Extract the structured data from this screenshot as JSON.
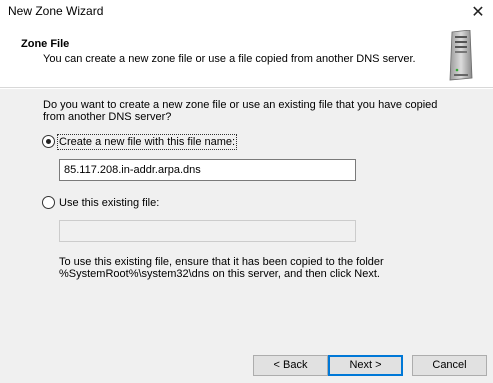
{
  "window": {
    "title": "New Zone Wizard",
    "close_glyph": "✕"
  },
  "header": {
    "title": "Zone File",
    "subtitle": "You can create a new zone file or use a file copied from another DNS server.",
    "icon": "server-icon"
  },
  "content": {
    "question": "Do you want to create a new zone file or use an existing file that you have copied from another DNS server?",
    "option_new": {
      "label": "Create a new file with this file name:",
      "selected": true,
      "value": "85.117.208.in-addr.arpa.dns"
    },
    "option_existing": {
      "label": "Use this existing file:",
      "selected": false,
      "value": ""
    },
    "note": "To use this existing file, ensure that it has been copied to the folder %SystemRoot%\\system32\\dns on this server, and then click Next."
  },
  "buttons": {
    "back": "< Back",
    "next": "Next >",
    "cancel": "Cancel"
  },
  "colors": {
    "accent": "#0078d7",
    "panel": "#f0f0f0"
  }
}
